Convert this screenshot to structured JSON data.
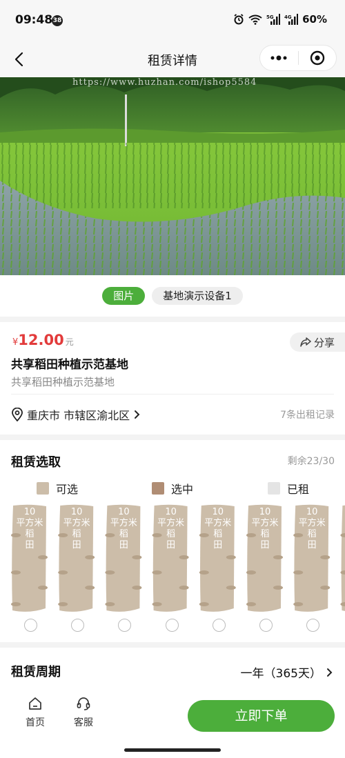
{
  "status_bar": {
    "time": "09:48",
    "badge": "38",
    "battery": "60%",
    "network_5g": "5G",
    "network_4g": "4G"
  },
  "nav": {
    "title": "租赁详情",
    "back_icon": "chevron-left-icon",
    "menu_icon": "more-dots-icon",
    "close_icon": "record-icon"
  },
  "hero": {
    "watermark": "https://www.huzhan.com/ishop5584",
    "tabs": [
      {
        "label": "图片",
        "active": true
      },
      {
        "label": "基地演示设备1",
        "active": false
      }
    ]
  },
  "info": {
    "price_symbol": "¥",
    "price": "12.00",
    "price_unit": "元",
    "share_label": "分享",
    "title": "共享稻田种植示范基地",
    "subtitle": "共享稻田种植示范基地",
    "location": "重庆市 市辖区渝北区",
    "rental_records": "7条出租记录"
  },
  "selection": {
    "title": "租赁选取",
    "remaining": "剩余23/30",
    "legend": [
      {
        "label": "可选",
        "color": "#ccbda9"
      },
      {
        "label": "选中",
        "color": "#b08d74"
      },
      {
        "label": "已租",
        "color": "#e4e4e4"
      }
    ],
    "plot_label": "10平方米稻田",
    "plots": [
      {
        "label_line1": "10",
        "label_line2": "平方米",
        "label_line3": "稻",
        "label_line4": "田",
        "selected": false
      },
      {
        "label_line1": "10",
        "label_line2": "平方米",
        "label_line3": "稻",
        "label_line4": "田",
        "selected": false
      },
      {
        "label_line1": "10",
        "label_line2": "平方米",
        "label_line3": "稻",
        "label_line4": "田",
        "selected": false
      },
      {
        "label_line1": "10",
        "label_line2": "平方米",
        "label_line3": "稻",
        "label_line4": "田",
        "selected": false
      },
      {
        "label_line1": "10",
        "label_line2": "平方米",
        "label_line3": "稻",
        "label_line4": "田",
        "selected": false
      },
      {
        "label_line1": "10",
        "label_line2": "平方米",
        "label_line3": "稻",
        "label_line4": "田",
        "selected": false
      },
      {
        "label_line1": "10",
        "label_line2": "平方米",
        "label_line3": "稻",
        "label_line4": "田",
        "selected": false
      }
    ]
  },
  "period": {
    "title": "租赁周期",
    "value": "一年（365天）"
  },
  "bottom": {
    "home_label": "首页",
    "service_label": "客服",
    "order_label": "立即下单"
  },
  "colors": {
    "accent_green": "#4cae3b",
    "price_red": "#e23b3b",
    "plot_available": "#ccbda9"
  }
}
